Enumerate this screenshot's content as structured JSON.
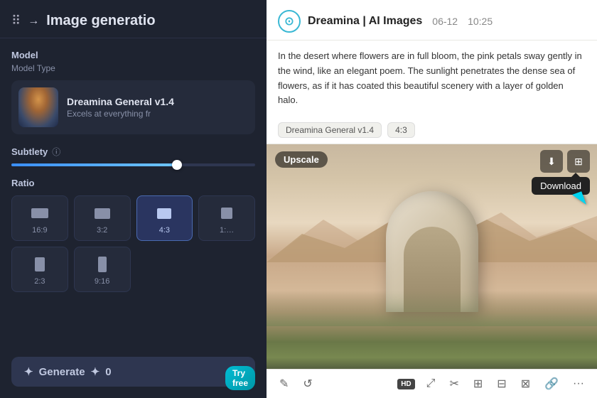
{
  "left_panel": {
    "header": {
      "title": "Image generatio",
      "hamburger": "☰",
      "arrow": "→"
    },
    "model_section": {
      "label": "Model",
      "sublabel": "Model Type",
      "name": "Dreamina General v1.4",
      "description": "Excels at everything fr"
    },
    "subtlety": {
      "label": "Subtlety",
      "info": "ⓘ",
      "value": 68
    },
    "ratio": {
      "label": "Ratio",
      "options": [
        {
          "id": "16:9",
          "label": "16:9",
          "active": false
        },
        {
          "id": "3:2",
          "label": "3:2",
          "active": false
        },
        {
          "id": "4:3",
          "label": "4:3",
          "active": true
        },
        {
          "id": "1:1",
          "label": "1:…",
          "active": false
        },
        {
          "id": "2:3",
          "label": "2:3",
          "active": false
        },
        {
          "id": "9:16",
          "label": "9:16",
          "active": false
        }
      ]
    },
    "generate": {
      "label": "Generate",
      "icon": "✦",
      "cost": "0"
    },
    "try_free": "Try free"
  },
  "right_panel": {
    "header": {
      "app_name": "Dreamina | AI Images",
      "date": "06-12",
      "time": "10:25"
    },
    "description": "In the desert where flowers are in full bloom, the pink petals sway gently in the wind, like an elegant poem. The sunlight penetrates the dense sea of flowers, as if it has coated this beautiful scenery with a layer of golden halo.",
    "tags": [
      "Dreamina General v1.4",
      "4:3"
    ],
    "image": {
      "upscale_label": "Upscale",
      "download_tooltip": "Download"
    },
    "toolbar": {
      "hd_badge": "HD",
      "icons": [
        "✎",
        "↺",
        "⊞",
        "⊟",
        "⊟",
        "⊠",
        "🔗",
        "⋯"
      ]
    }
  }
}
